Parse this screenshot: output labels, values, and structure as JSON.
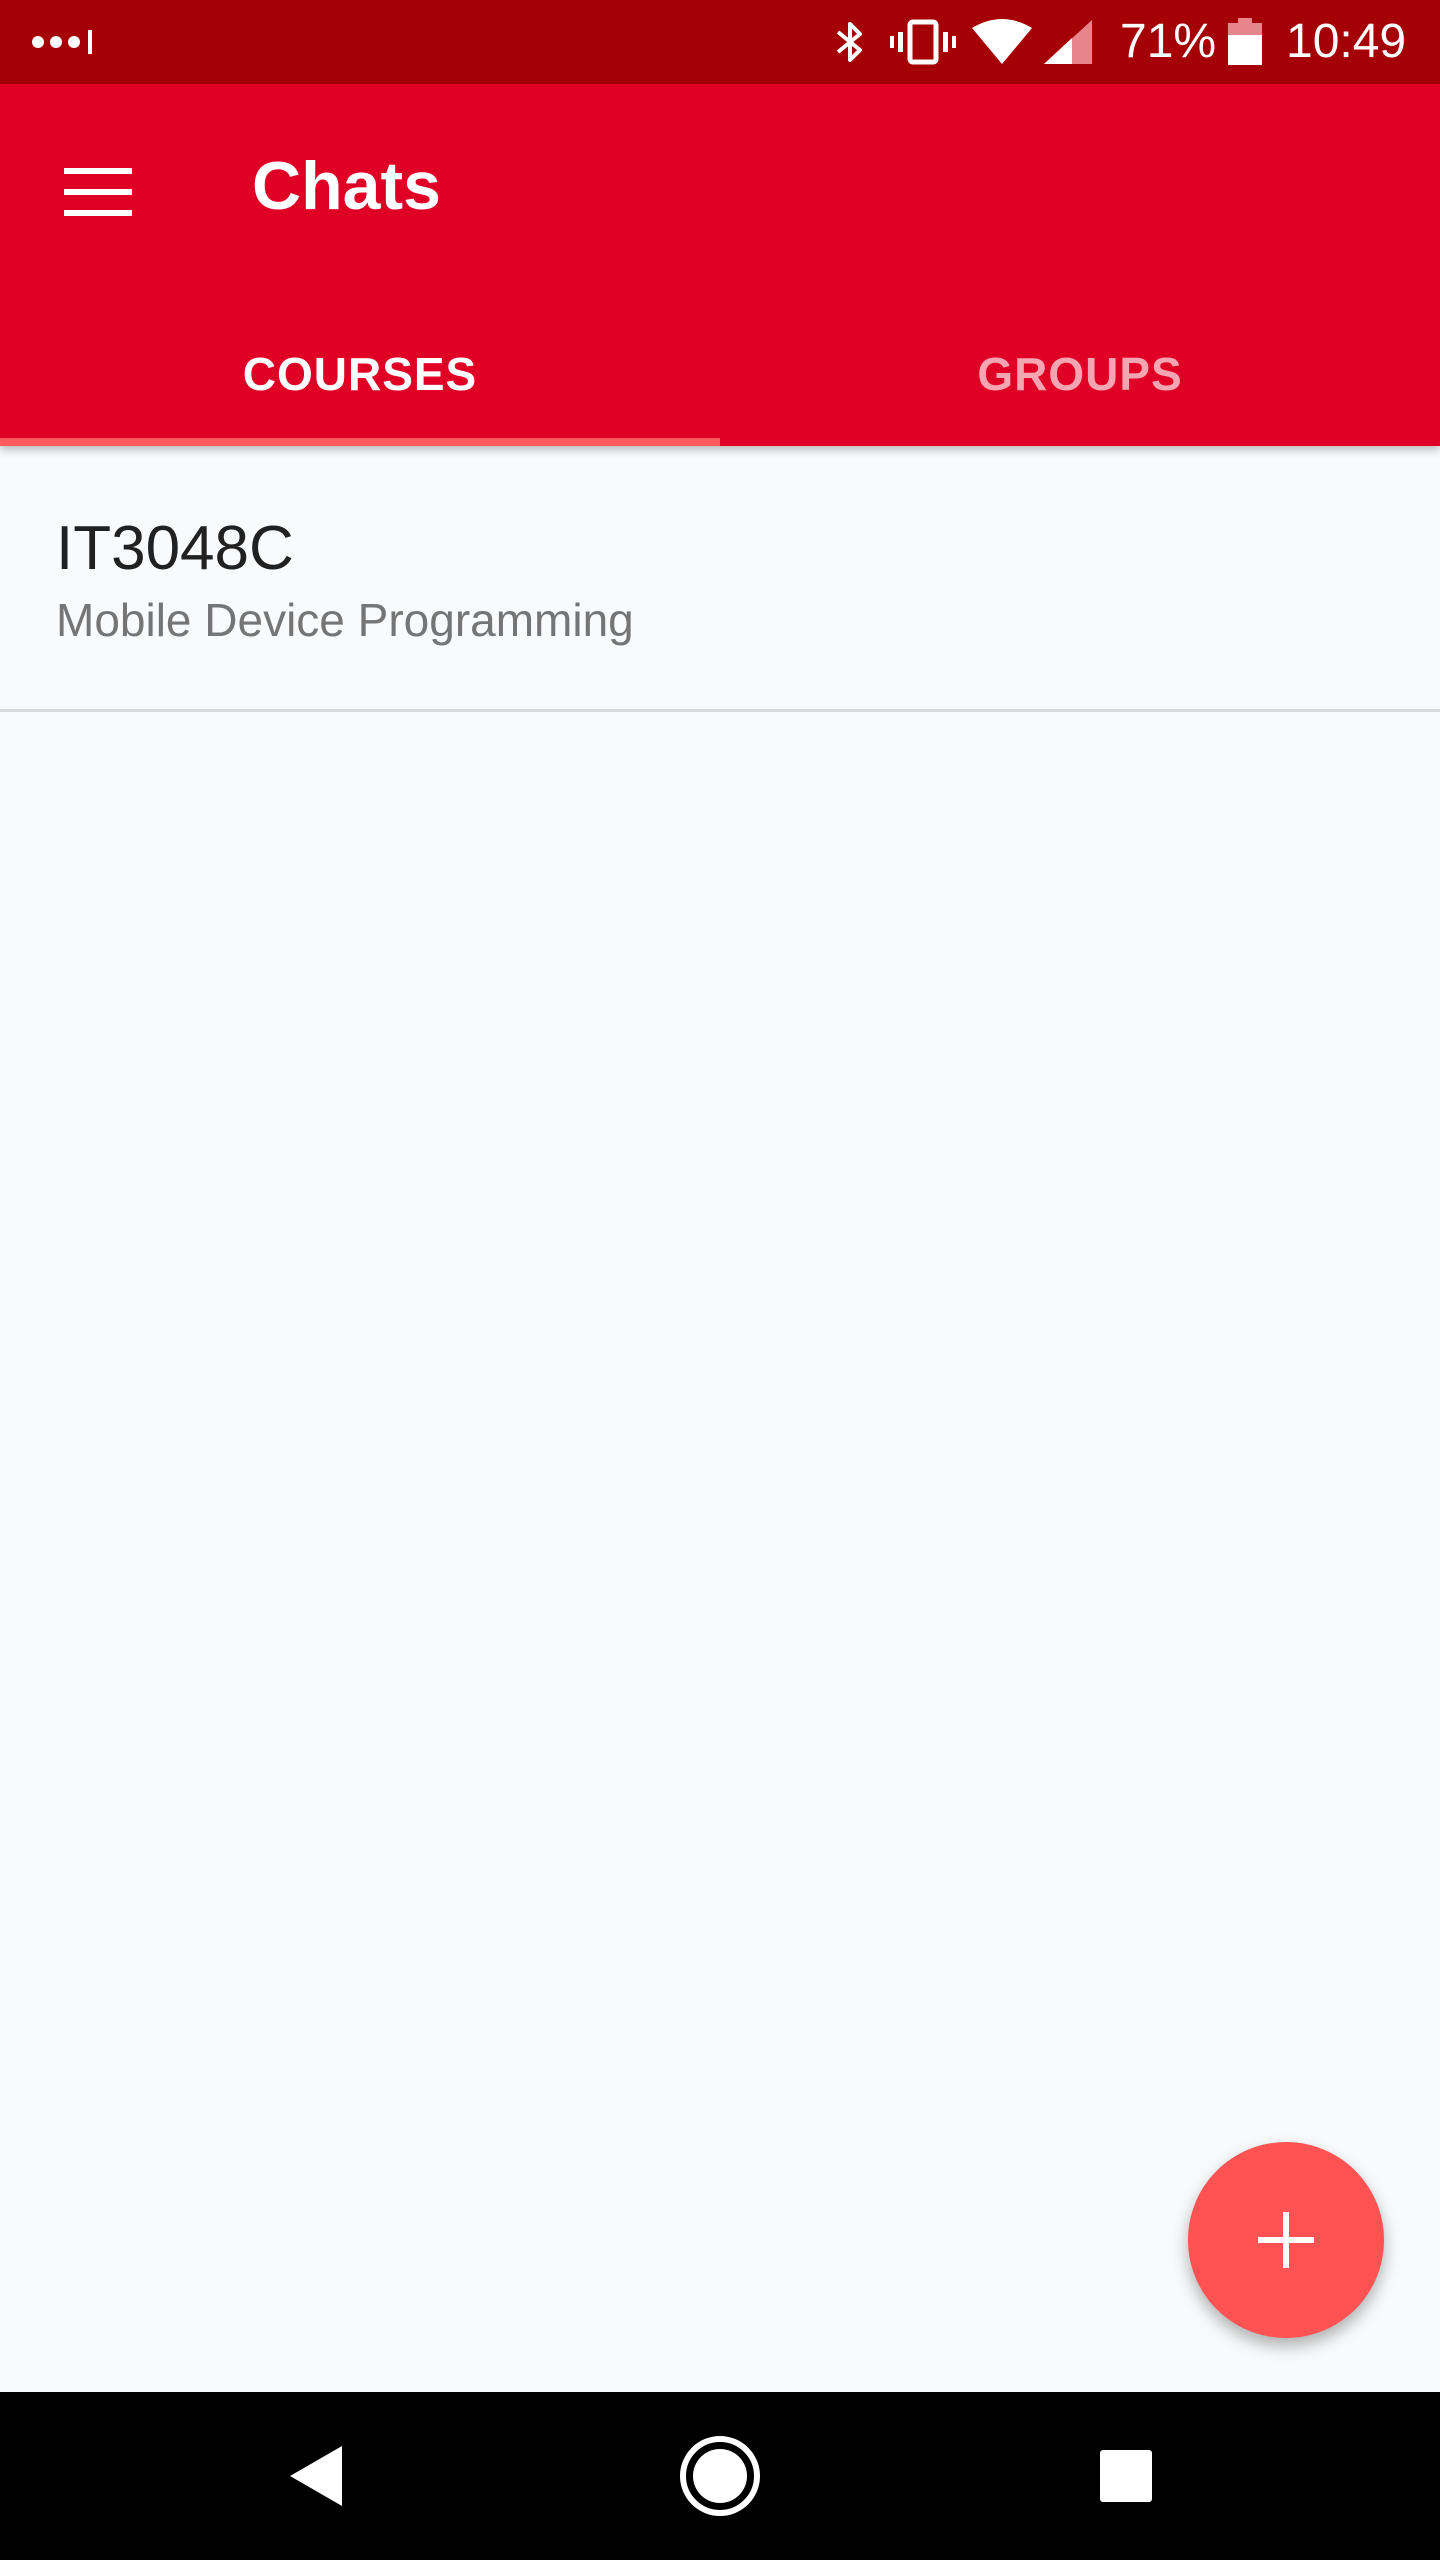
{
  "status_bar": {
    "battery_percent": "71%",
    "time": "10:49",
    "icons": [
      "notification-dots-icon",
      "bluetooth-icon",
      "vibrate-icon",
      "wifi-icon",
      "cellular-signal-icon",
      "battery-icon"
    ],
    "color": "#a50006"
  },
  "app_bar": {
    "title": "Chats",
    "menu_icon": "hamburger-menu-icon",
    "color": "#e00026",
    "tabs": [
      {
        "label": "COURSES",
        "active": true
      },
      {
        "label": "GROUPS",
        "active": false
      }
    ]
  },
  "list": {
    "items": [
      {
        "title": "IT3048C",
        "subtitle": "Mobile Device Programming"
      }
    ]
  },
  "fab": {
    "icon": "plus-icon",
    "color": "#ff5252"
  },
  "nav_bar": {
    "buttons": [
      "back-icon",
      "home-icon",
      "recents-icon"
    ]
  }
}
